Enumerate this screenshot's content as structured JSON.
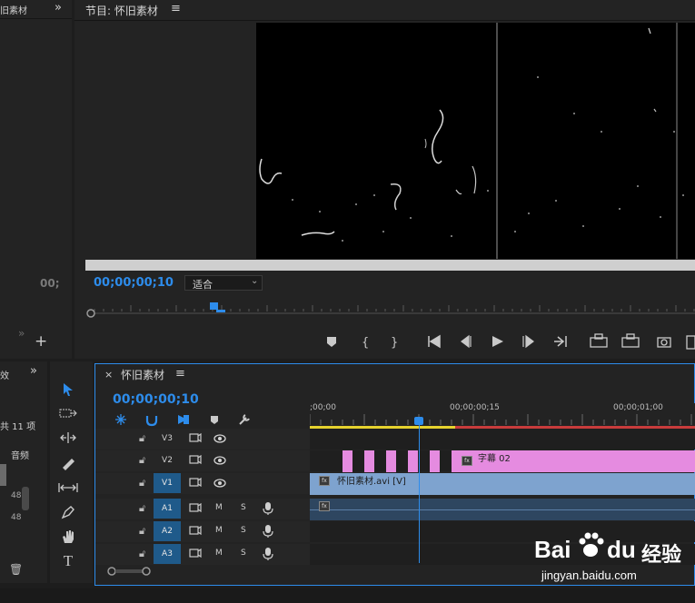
{
  "left_panel": {
    "title": "旧素材",
    "menu_icon": "double-chevron-right-icon",
    "timecode": "00;",
    "add_icon": "plus-icon"
  },
  "program": {
    "title": "节目: 怀旧素材",
    "timecode": "00;00;00;10",
    "fit_value": "适合",
    "playhead_fraction": 0.21
  },
  "project_small": {
    "title": "效",
    "count": "共 11 项",
    "col_header": "音频",
    "rows": [
      "",
      "48",
      "48"
    ]
  },
  "timeline": {
    "close": "×",
    "title": "怀旧素材",
    "timecode": "00;00;00;10",
    "ruler": [
      ";00;00",
      "00;00;00;15",
      "00;00;01;00"
    ],
    "tracks": [
      {
        "id": "V3",
        "active": false,
        "type": "video"
      },
      {
        "id": "V2",
        "active": false,
        "type": "video"
      },
      {
        "id": "V1",
        "active": true,
        "type": "video"
      },
      {
        "id": "A1",
        "active": true,
        "type": "audio"
      },
      {
        "id": "A2",
        "active": true,
        "type": "audio"
      },
      {
        "id": "A3",
        "active": true,
        "type": "audio"
      }
    ],
    "mute_label": "M",
    "solo_label": "S",
    "clips": {
      "caption": "字幕 02",
      "video": "怀旧素材.avi [V]",
      "fx": "fx"
    },
    "colors": {
      "caption": "#e58be0",
      "video": "#7ea3cf",
      "audio": "#2e4660",
      "accent": "#2d8ceb"
    }
  },
  "watermark": {
    "logo_a": "Bai",
    "logo_b": "du",
    "logo_cn": "经验",
    "url": "jingyan.baidu.com"
  }
}
